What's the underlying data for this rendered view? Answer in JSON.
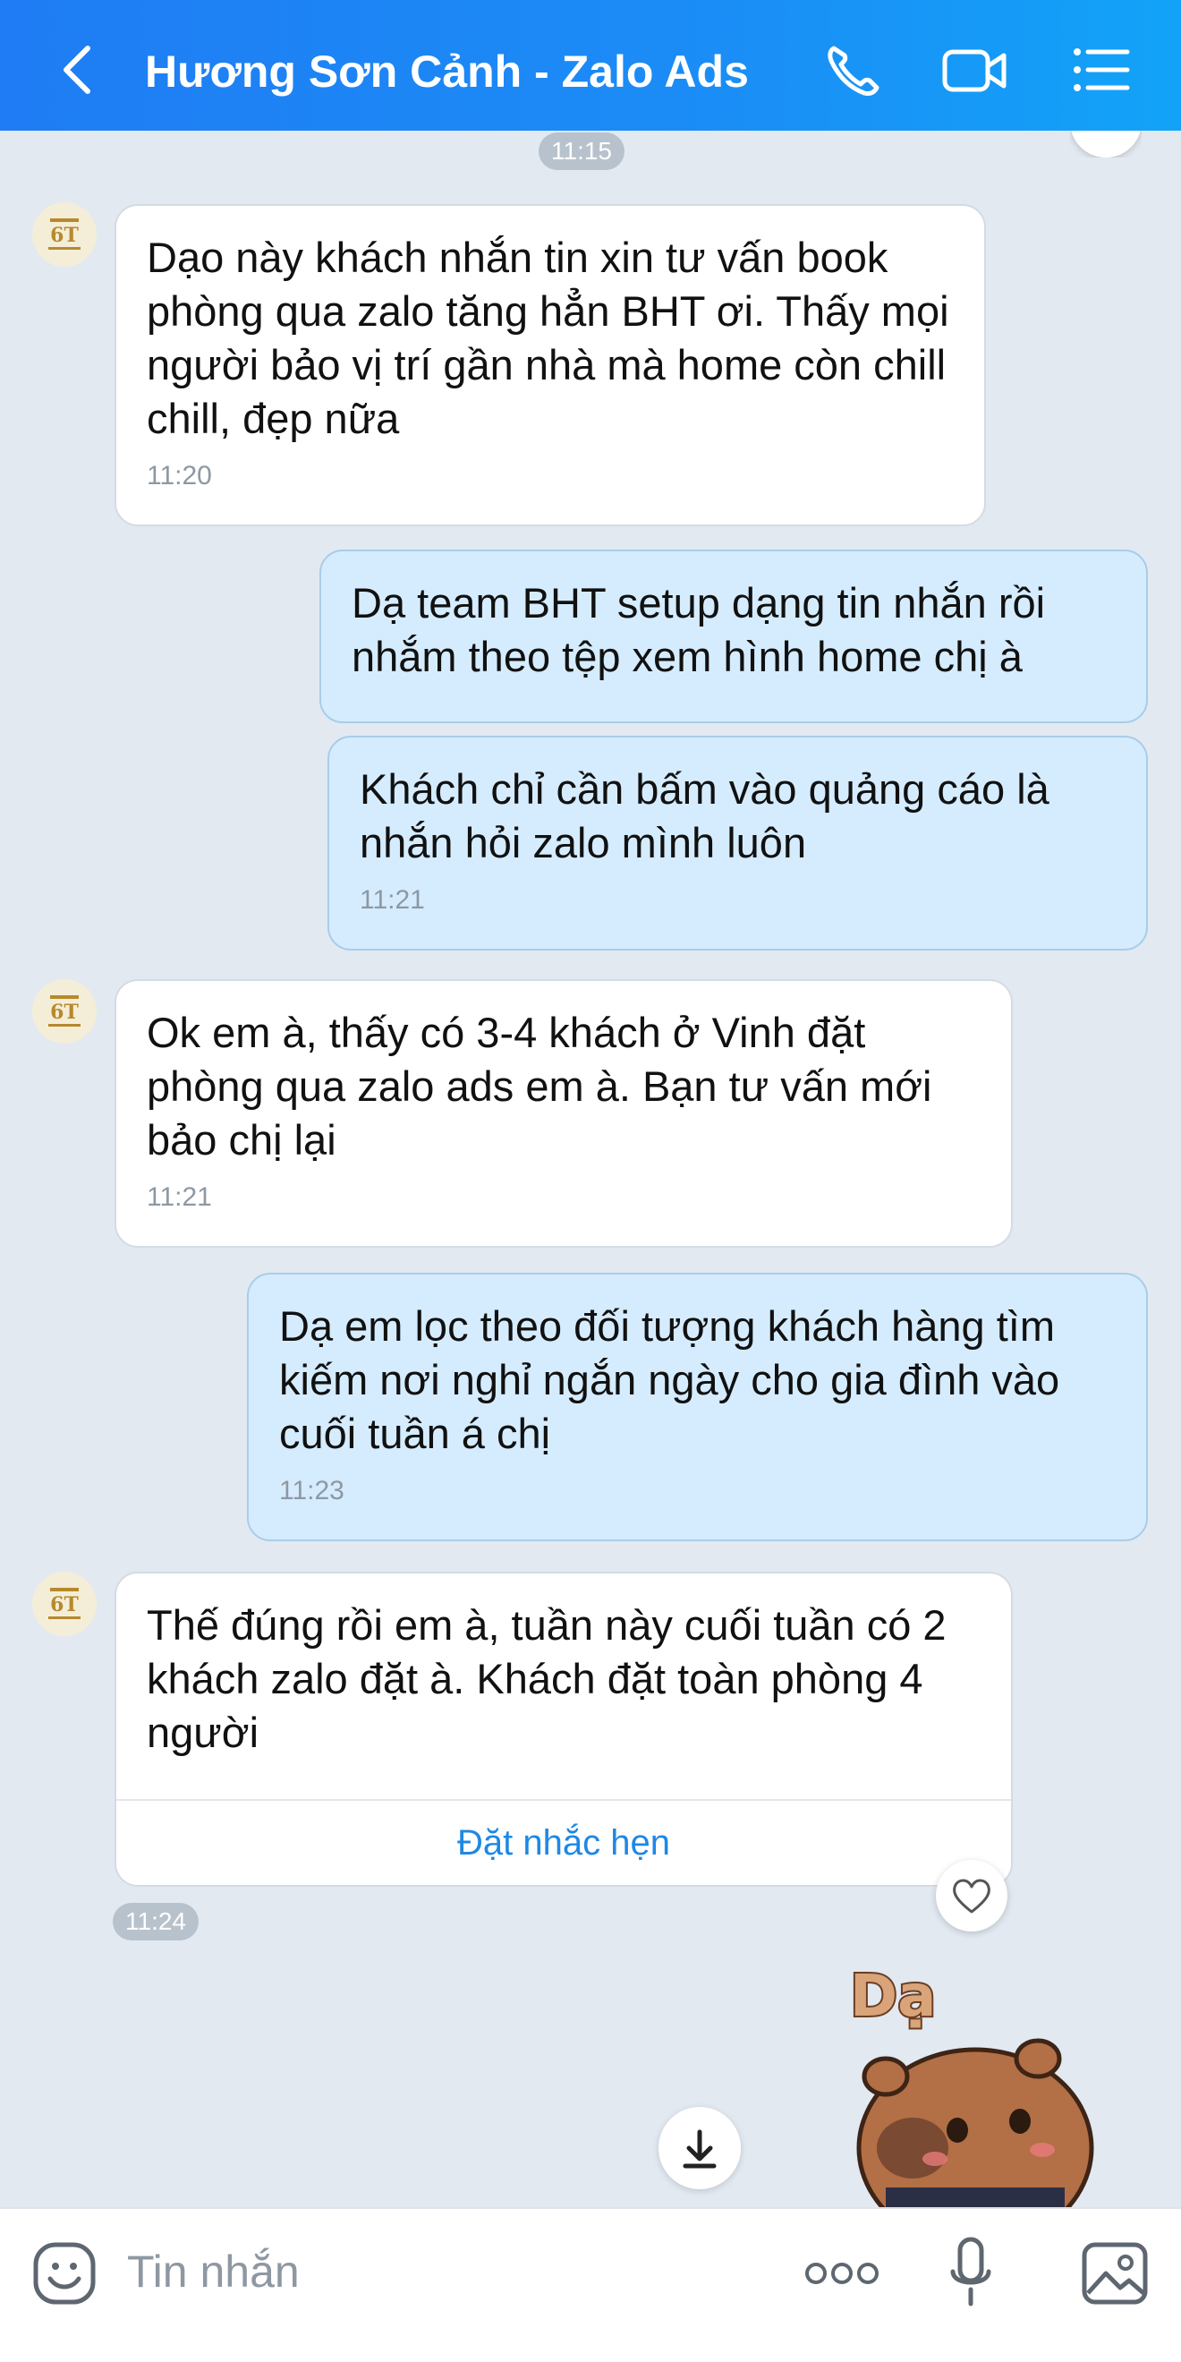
{
  "header": {
    "title": "Hương Sơn Cảnh - Zalo Ads",
    "icons": [
      "back-chevron-icon",
      "phone-icon",
      "video-camera-icon",
      "list-menu-icon"
    ],
    "color": "#1f7cf4"
  },
  "top_time": "11:15",
  "messages": [
    {
      "side": "in",
      "text": "Dạo này khách nhắn tin xin tư vấn book phòng qua zalo tăng hẳn BHT ơi. Thấy mọi người bảo vị trí gần nhà mà home còn chill chill, đẹp nữa",
      "time": "11:20"
    },
    {
      "side": "out",
      "text": "Dạ team BHT setup dạng tin nhắn rồi nhắm theo tệp xem hình home chị à",
      "time": ""
    },
    {
      "side": "out",
      "text": "Khách chỉ cần bấm vào quảng cáo là nhắn hỏi zalo mình luôn",
      "time": "11:21"
    },
    {
      "side": "in",
      "text": "Ok em à, thấy có 3-4 khách ở Vinh đặt phòng qua zalo ads em à. Bạn tư vấn mới bảo chị lại",
      "time": "11:21"
    },
    {
      "side": "out",
      "text": "Dạ em lọc theo đối tượng khách hàng tìm kiếm nơi nghỉ ngắn ngày cho gia đình vào cuối tuần á chị",
      "time": "11:23"
    },
    {
      "side": "in",
      "text": "Thế đúng rồi em à, tuần này cuối tuần có 2 khách zalo đặt à. Khách đặt toàn phòng 4 người",
      "time": "11:24",
      "action": "Đặt nhắc hẹn"
    }
  ],
  "sticker": {
    "text": "Dạ"
  },
  "composer": {
    "placeholder": "Tin nhắn",
    "icons": [
      "emoji-icon",
      "more-dots-icon",
      "microphone-icon",
      "image-icon"
    ]
  },
  "colors": {
    "outgoing_bubble": "#d5ecfe",
    "incoming_bubble": "#ffffff",
    "background": "#e2e9f1",
    "link": "#1e88e5"
  }
}
